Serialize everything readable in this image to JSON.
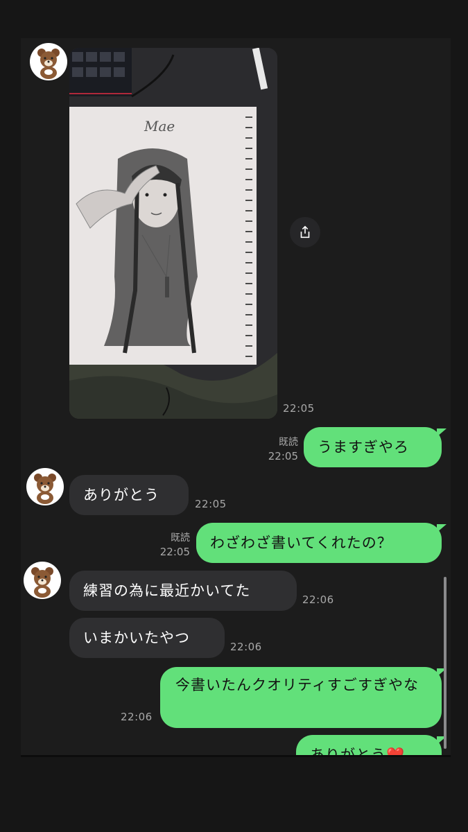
{
  "photo_caption": "Mae",
  "messages": [
    {
      "time": "22:05"
    },
    {
      "read": "既読",
      "time": "22:05",
      "text": "うますぎやろ"
    },
    {
      "text": "ありがとう",
      "time": "22:05"
    },
    {
      "read": "既読",
      "time": "22:05",
      "text": "わざわざ書いてくれたの？"
    },
    {
      "text": "練習の為に最近かいてた",
      "time": "22:06"
    },
    {
      "text": "いまかいたやつ",
      "time": "22:06"
    },
    {
      "time": "22:06",
      "text": "今書いたんクオリティすごすぎやな"
    },
    {
      "text": "ありがとう",
      "emoji": "❤️"
    }
  ],
  "colors": {
    "outgoing_bubble": "#62e07a",
    "incoming_bubble": "#2f2f31",
    "background": "#1c1c1c"
  },
  "icons": [
    "teddy-bear-avatar-icon",
    "share-icon"
  ]
}
